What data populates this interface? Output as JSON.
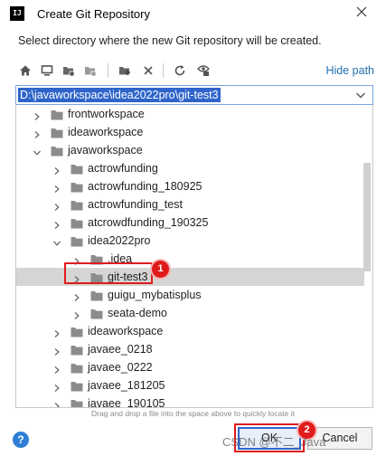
{
  "window": {
    "title": "Create Git Repository",
    "app_icon_text": "IJ",
    "close_icon": "close-icon"
  },
  "description": "Select directory where the new Git repository will be created.",
  "toolbar": {
    "icons": [
      "home-icon",
      "desktop-icon",
      "project-folder-icon",
      "module-folder-icon",
      "new-folder-icon",
      "delete-icon",
      "refresh-icon",
      "show-hidden-icon"
    ],
    "hide_path_label": "Hide path"
  },
  "path": {
    "value": "D:\\javaworkspace\\idea2022pro\\git-test3"
  },
  "tree": {
    "items": [
      {
        "label": "frontworkspace",
        "depth": 0,
        "expanded": false
      },
      {
        "label": "ideaworkspace",
        "depth": 0,
        "expanded": false
      },
      {
        "label": "javaworkspace",
        "depth": 0,
        "expanded": true
      },
      {
        "label": "actrowfunding",
        "depth": 1,
        "expanded": false
      },
      {
        "label": "actrowfunding_180925",
        "depth": 1,
        "expanded": false
      },
      {
        "label": "actrowfunding_test",
        "depth": 1,
        "expanded": false
      },
      {
        "label": "atcrowdfunding_190325",
        "depth": 1,
        "expanded": false
      },
      {
        "label": "idea2022pro",
        "depth": 1,
        "expanded": true
      },
      {
        "label": ".idea",
        "depth": 2,
        "expanded": false
      },
      {
        "label": "git-test3",
        "depth": 2,
        "expanded": false,
        "selected": true
      },
      {
        "label": "guigu_mybatisplus",
        "depth": 2,
        "expanded": false
      },
      {
        "label": "seata-demo",
        "depth": 2,
        "expanded": false
      },
      {
        "label": "ideaworkspace",
        "depth": 1,
        "expanded": false
      },
      {
        "label": "javaee_0218",
        "depth": 1,
        "expanded": false
      },
      {
        "label": "javaee_0222",
        "depth": 1,
        "expanded": false
      },
      {
        "label": "javaee_181205",
        "depth": 1,
        "expanded": false
      },
      {
        "label": "javaee_190105",
        "depth": 1,
        "expanded": false
      }
    ]
  },
  "hint": "Drag and drop a file into the space above to quickly locate it",
  "buttons": {
    "help_label": "?",
    "ok_label": "OK",
    "cancel_label": "Cancel"
  },
  "annotations": {
    "badge_1": "1",
    "badge_2": "2",
    "color": "#e01b1b"
  },
  "watermark": "CSDN @不二_Java"
}
